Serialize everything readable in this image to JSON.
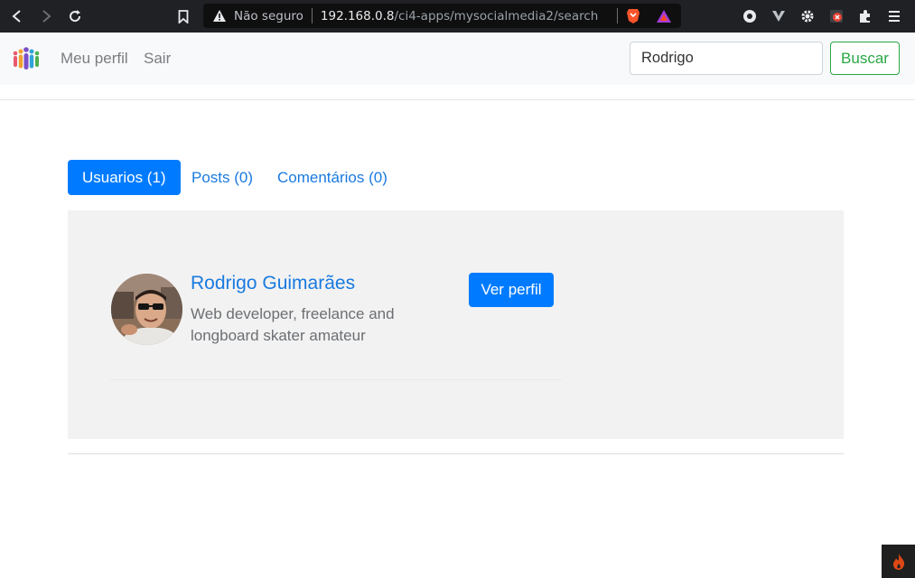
{
  "browser": {
    "security_label": "Não seguro",
    "url_host": "192.168.0.8",
    "url_path": "/ci4-apps/mysocialmedia2/search",
    "icons": [
      "back-icon",
      "forward-icon",
      "reload-icon",
      "bookmark-icon",
      "warning-icon",
      "brave-shield-icon",
      "brave-rewards-icon",
      "extension-icon",
      "extensions-icon",
      "menu-icon"
    ]
  },
  "navbar": {
    "links": [
      {
        "label": "Meu perfil"
      },
      {
        "label": "Sair"
      }
    ],
    "search_value": "Rodrigo",
    "search_button": "Buscar"
  },
  "tabs": [
    {
      "label": "Usuarios (1)",
      "active": true
    },
    {
      "label": "Posts (0)",
      "active": false
    },
    {
      "label": "Comentários (0)",
      "active": false
    }
  ],
  "results": [
    {
      "name": "Rodrigo Guimarães",
      "bio": "Web developer, freelance and longboard skater amateur",
      "button": "Ver perfil"
    }
  ],
  "colors": {
    "primary": "#007bff",
    "success": "#28a745",
    "panel_bg": "#f2f2f2",
    "navbar_bg": "#f8f9fa"
  }
}
